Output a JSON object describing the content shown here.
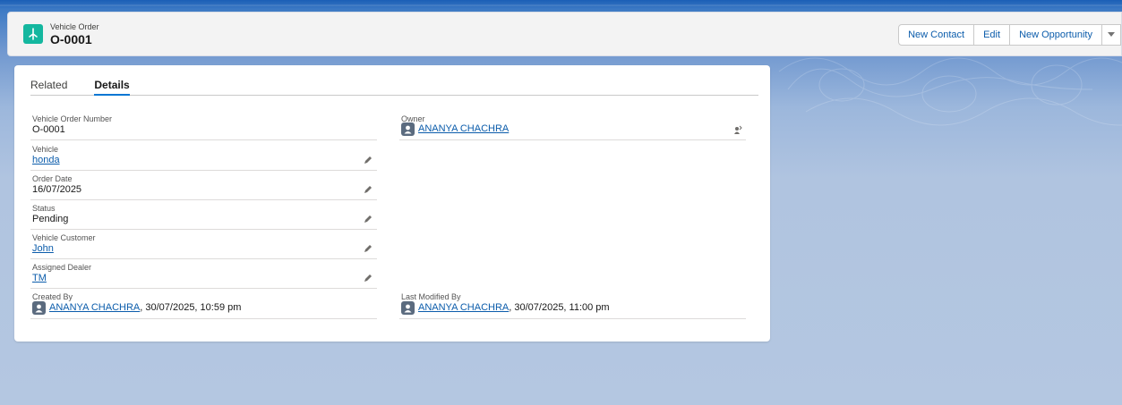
{
  "header": {
    "object_label": "Vehicle Order",
    "record_title": "O-0001",
    "buttons": [
      "New Contact",
      "Edit",
      "New Opportunity"
    ],
    "icon": "vehicle-order-icon"
  },
  "tabs": [
    {
      "label": "Related",
      "active": false
    },
    {
      "label": "Details",
      "active": true
    }
  ],
  "fields": {
    "vehicle_order_number": {
      "label": "Vehicle Order Number",
      "value": "O-0001"
    },
    "vehicle": {
      "label": "Vehicle",
      "value": "honda"
    },
    "order_date": {
      "label": "Order Date",
      "value": "16/07/2025"
    },
    "status": {
      "label": "Status",
      "value": "Pending"
    },
    "vehicle_customer": {
      "label": "Vehicle Customer",
      "value": "John"
    },
    "assigned_dealer": {
      "label": "Assigned Dealer",
      "value": "TM"
    },
    "created_by": {
      "label": "Created By",
      "user": "ANANYA CHACHRA",
      "timestamp": ", 30/07/2025, 10:59 pm"
    },
    "owner": {
      "label": "Owner",
      "user": "ANANYA CHACHRA"
    },
    "last_modified_by": {
      "label": "Last Modified By",
      "user": "ANANYA CHACHRA",
      "timestamp": ", 30/07/2025, 11:00 pm"
    }
  },
  "colors": {
    "accent": "#0176d3",
    "link": "#0b5cab",
    "object_icon": "#14b79f"
  }
}
